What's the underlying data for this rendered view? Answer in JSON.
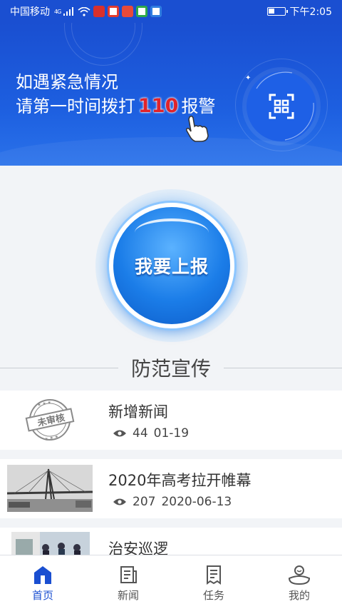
{
  "status_bar": {
    "carrier": "中国移动",
    "network": "4G",
    "time": "下午2:05"
  },
  "banner": {
    "line1": "如遇紧急情况",
    "line2_prefix": "请第一时间拨打",
    "emergency_number": "110",
    "line2_suffix": "报警",
    "scan_icon": "scan-icon",
    "number_color": "#e0232b",
    "background_color": "#1a4fd1"
  },
  "report_button": {
    "label": "我要上报"
  },
  "section": {
    "title": "防范宣传"
  },
  "news": [
    {
      "title": "新增新闻",
      "views": "44",
      "date": "01-19",
      "thumb": "stamp-unreviewed",
      "stamp_text": "未审核"
    },
    {
      "title": "2020年高考拉开帷幕",
      "views": "207",
      "date": "2020-06-13",
      "thumb": "bridge-photo"
    },
    {
      "title": "治安巡逻",
      "thumb": "patrol-photo"
    }
  ],
  "nav": {
    "items": [
      {
        "label": "首页",
        "icon": "home-icon",
        "active": true
      },
      {
        "label": "新闻",
        "icon": "news-icon",
        "active": false
      },
      {
        "label": "任务",
        "icon": "task-icon",
        "active": false
      },
      {
        "label": "我的",
        "icon": "profile-icon",
        "active": false
      }
    ],
    "active_color": "#1a4fd1"
  }
}
